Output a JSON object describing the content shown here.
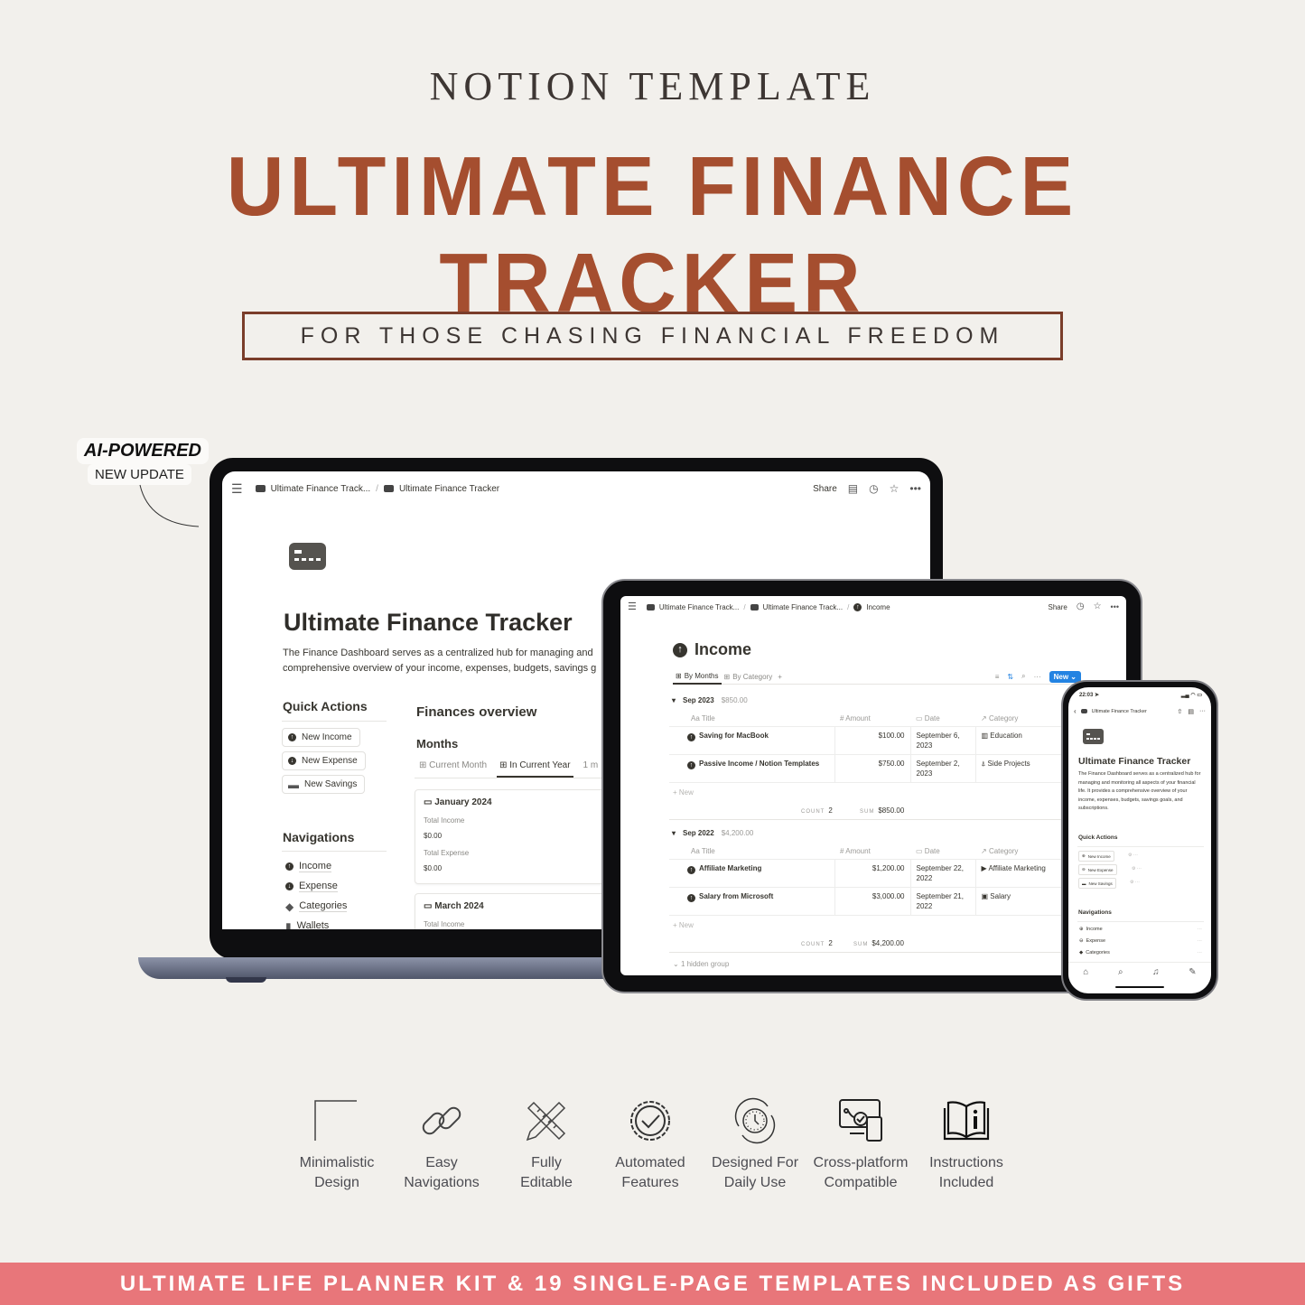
{
  "header": {
    "kicker": "NOTION TEMPLATE",
    "title": "ULTIMATE FINANCE TRACKER",
    "tagline": "FOR THOSE CHASING FINANCIAL FREEDOM"
  },
  "badge": {
    "title": "AI-POWERED",
    "subtitle": "NEW UPDATE"
  },
  "laptop": {
    "breadcrumbs": [
      "Ultimate Finance Track...",
      "Ultimate Finance Tracker"
    ],
    "share_label": "Share",
    "page_title": "Ultimate Finance Tracker",
    "description_line1": "The Finance Dashboard serves as a centralized hub for managing and",
    "description_line2": "comprehensive overview of your income, expenses, budgets, savings g",
    "quick_actions": {
      "heading": "Quick Actions",
      "buttons": [
        "New Income",
        "New Expense",
        "New Savings"
      ]
    },
    "navigations": {
      "heading": "Navigations",
      "items": [
        "Income",
        "Expense",
        "Categories",
        "Wallets"
      ]
    },
    "overview": {
      "heading": "Finances overview",
      "subheading": "Months",
      "tabs": [
        "Current Month",
        "In Current Year",
        "1 m"
      ],
      "active_tab": "In Current Year",
      "cards": [
        {
          "month": "January 2024",
          "income_label": "Total Income",
          "income": "$0.00",
          "expense_label": "Total Expense",
          "expense": "$0.00"
        },
        {
          "month": "March 2024",
          "income_label": "Total Income"
        }
      ]
    }
  },
  "tablet": {
    "breadcrumbs": [
      "Ultimate Finance Track...",
      "Ultimate Finance Track...",
      "Income"
    ],
    "share_label": "Share",
    "page_title": "Income",
    "views": [
      "By Months",
      "By Category"
    ],
    "active_view": "By Months",
    "new_button": "New",
    "columns": [
      "Title",
      "Amount",
      "Date",
      "Category"
    ],
    "column_icons": [
      "Aa",
      "#",
      "▭",
      "↗"
    ],
    "groups": [
      {
        "name": "Sep 2023",
        "total": "$850.00",
        "rows": [
          {
            "title": "Saving for MacBook",
            "amount": "$100.00",
            "date_line1": "September 6,",
            "date_line2": "2023",
            "category": "Education",
            "category_icon": "book-icon"
          },
          {
            "title": "Passive Income / Notion Templates",
            "amount": "$750.00",
            "date_line1": "September 2,",
            "date_line2": "2023",
            "category": "Side Projects",
            "category_icon": "pin-icon"
          }
        ],
        "new_label": "+ New",
        "count_label": "COUNT",
        "count": "2",
        "sum_label": "SUM",
        "sum": "$850.00"
      },
      {
        "name": "Sep 2022",
        "total": "$4,200.00",
        "rows": [
          {
            "title": "Affiliate Marketing",
            "amount": "$1,200.00",
            "date_line1": "September 22,",
            "date_line2": "2022",
            "category": "Affiliate Marketing",
            "category_icon": "flag-icon"
          },
          {
            "title": "Salary from Microsoft",
            "amount": "$3,000.00",
            "date_line1": "September 21,",
            "date_line2": "2022",
            "category": "Salary",
            "category_icon": "briefcase-icon"
          }
        ],
        "new_label": "+ New",
        "count_label": "COUNT",
        "count": "2",
        "sum_label": "SUM",
        "sum": "$4,200.00"
      }
    ],
    "hidden_group": "1 hidden group"
  },
  "phone": {
    "time": "22:03",
    "breadcrumb": "Ultimate Finance Tracker",
    "page_title": "Ultimate Finance Tracker",
    "description": "The Finance Dashboard serves as a centralized hub for managing and monitoring all aspects of your financial life. It provides a comprehensive overview of your income, expenses, budgets, savings goals, and subscriptions.",
    "quick_actions_heading": "Quick Actions",
    "quick_actions": [
      "New Income",
      "New Expense",
      "New Savings"
    ],
    "navigations_heading": "Navigations",
    "navigations": [
      "Income",
      "Expense",
      "Categories"
    ]
  },
  "features": [
    {
      "icon": "corner-icon",
      "line1": "Minimalistic",
      "line2": "Design"
    },
    {
      "icon": "link-icon",
      "line1": "Easy",
      "line2": "Navigations"
    },
    {
      "icon": "pencil-ruler-icon",
      "line1": "Fully",
      "line2": "Editable"
    },
    {
      "icon": "gear-check-icon",
      "line1": "Automated",
      "line2": "Features"
    },
    {
      "icon": "clock-cycle-icon",
      "line1": "Designed For",
      "line2": "Daily Use"
    },
    {
      "icon": "devices-icon",
      "line1": "Cross-platform",
      "line2": "Compatible"
    },
    {
      "icon": "book-info-icon",
      "line1": "Instructions",
      "line2": "Included"
    }
  ],
  "footer": {
    "text": "ULTIMATE LIFE PLANNER KIT & 19 SINGLE-PAGE TEMPLATES INCLUDED AS GIFTS"
  },
  "colors": {
    "background": "#f2f0ec",
    "title": "#a54e2f",
    "footer": "#e8767a",
    "notion_blue": "#2383e2"
  }
}
